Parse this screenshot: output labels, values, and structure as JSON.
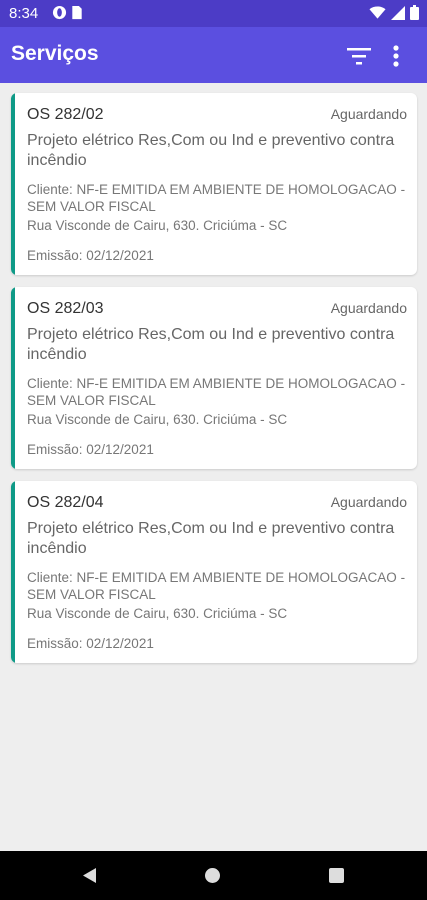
{
  "status_bar": {
    "time": "8:34",
    "icons_left": [
      "opera-icon",
      "sim-card-icon"
    ],
    "icons_right": [
      "wifi-icon",
      "signal-icon",
      "battery-icon"
    ]
  },
  "app_bar": {
    "title": "Serviços",
    "actions": [
      "filter-icon",
      "more-vert-icon"
    ]
  },
  "colors": {
    "status_bar": "#4c3cc6",
    "app_bar": "#5b4fe0",
    "accent": "#0f9a87",
    "background": "#eeeeee"
  },
  "services": [
    {
      "number": "OS 282/02",
      "status": "Aguardando",
      "description": "Projeto elétrico Res,Com ou Ind e preventivo contra incêndio",
      "client": "Cliente: NF-E EMITIDA EM AMBIENTE DE HOMOLOGACAO - SEM VALOR FISCAL",
      "address": "Rua Visconde de Cairu, 630. Criciúma - SC",
      "date": "Emissão: 02/12/2021"
    },
    {
      "number": "OS 282/03",
      "status": "Aguardando",
      "description": "Projeto elétrico Res,Com ou Ind e preventivo contra incêndio",
      "client": "Cliente: NF-E EMITIDA EM AMBIENTE DE HOMOLOGACAO - SEM VALOR FISCAL",
      "address": "Rua Visconde de Cairu, 630. Criciúma - SC",
      "date": "Emissão: 02/12/2021"
    },
    {
      "number": "OS 282/04",
      "status": "Aguardando",
      "description": "Projeto elétrico Res,Com ou Ind e preventivo contra incêndio",
      "client": "Cliente: NF-E EMITIDA EM AMBIENTE DE HOMOLOGACAO - SEM VALOR FISCAL",
      "address": "Rua Visconde de Cairu, 630. Criciúma - SC",
      "date": "Emissão: 02/12/2021"
    }
  ],
  "nav_bar": [
    "back-icon",
    "home-icon",
    "recents-icon"
  ]
}
